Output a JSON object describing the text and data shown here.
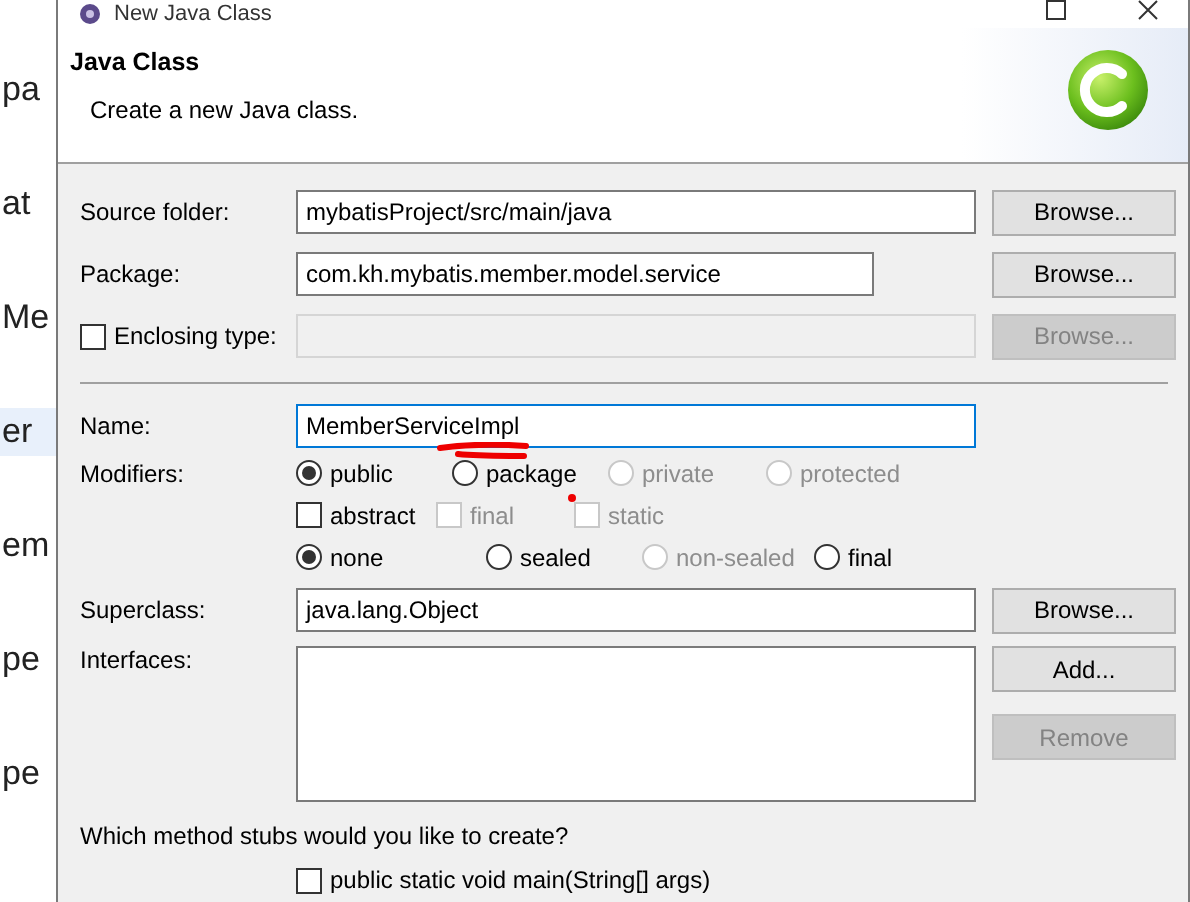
{
  "background_editor": {
    "lines": [
      {
        "text": "pa",
        "selected": false
      },
      {
        "text": "at",
        "selected": false
      },
      {
        "text": "Me",
        "selected": false
      },
      {
        "text": "er",
        "selected": true
      },
      {
        "text": "em",
        "selected": false
      },
      {
        "text": "pe",
        "selected": false
      },
      {
        "text": "pe",
        "selected": false
      }
    ]
  },
  "window": {
    "title": "New Java Class"
  },
  "header": {
    "title": "Java Class",
    "description": "Create a new Java class."
  },
  "fields": [
    {
      "kind": "text",
      "label": "Source folder:",
      "value": "mybatisProject/src/main/java",
      "button": {
        "label": "Browse...",
        "disabled": false
      }
    },
    {
      "kind": "text",
      "label": "Package:",
      "value": "com.kh.mybatis.member.model.service",
      "button": {
        "label": "Browse...",
        "disabled": false
      }
    },
    {
      "kind": "checkbox",
      "label": "Enclosing type:",
      "checked": false,
      "value_disabled": true,
      "button": {
        "label": "Browse...",
        "disabled": true
      }
    }
  ],
  "name": {
    "label": "Name:",
    "value": "MemberServiceImpl"
  },
  "modifiers": {
    "label": "Modifiers:",
    "rows": [
      [
        {
          "kind": "radio",
          "label": "public",
          "selected": true,
          "disabled": false
        },
        {
          "kind": "radio",
          "label": "package",
          "selected": false,
          "disabled": false
        },
        {
          "kind": "radio",
          "label": "private",
          "selected": false,
          "disabled": true
        },
        {
          "kind": "radio",
          "label": "protected",
          "selected": false,
          "disabled": true
        }
      ],
      [
        {
          "kind": "checkbox",
          "label": "abstract",
          "checked": false,
          "disabled": false
        },
        {
          "kind": "checkbox",
          "label": "final",
          "checked": false,
          "disabled": true
        },
        {
          "kind": "checkbox",
          "label": "static",
          "checked": false,
          "disabled": true
        }
      ],
      [
        {
          "kind": "radio",
          "label": "none",
          "selected": true,
          "disabled": false
        },
        {
          "kind": "radio",
          "label": "sealed",
          "selected": false,
          "disabled": false
        },
        {
          "kind": "radio",
          "label": "non-sealed",
          "selected": false,
          "disabled": true
        },
        {
          "kind": "radio",
          "label": "final",
          "selected": false,
          "disabled": false
        }
      ]
    ]
  },
  "superclass": {
    "label": "Superclass:",
    "value": "java.lang.Object",
    "button": {
      "label": "Browse...",
      "disabled": false
    }
  },
  "interfaces": {
    "label": "Interfaces:",
    "buttons": [
      {
        "label": "Add...",
        "disabled": false
      },
      {
        "label": "Remove",
        "disabled": true
      }
    ]
  },
  "stubs": {
    "question": "Which method stubs would you like to create?",
    "options": [
      {
        "label": "public static void main(String[] args)",
        "checked": false
      }
    ]
  }
}
